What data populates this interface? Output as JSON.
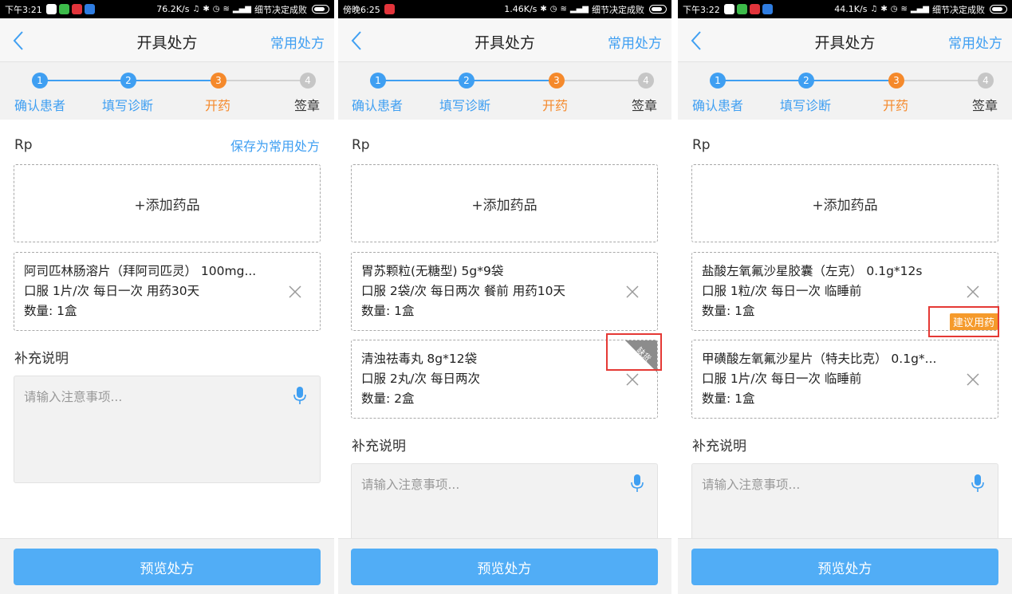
{
  "colors": {
    "accent": "#3f9ff2",
    "active_step": "#f5892b",
    "done_step": "#3f9ff2",
    "pending_step": "#c6c6c6",
    "button": "#51adf6",
    "alert": "#e53935",
    "suggest": "#f59a2b"
  },
  "screens": [
    {
      "status": {
        "time": "下午3:21",
        "speed": "76.2K/s",
        "carrier": "细节决定成败"
      },
      "nav": {
        "title": "开具处方",
        "action": "常用处方"
      },
      "steps": [
        {
          "num": "1",
          "label": "确认患者"
        },
        {
          "num": "2",
          "label": "填写诊断"
        },
        {
          "num": "3",
          "label": "开药"
        },
        {
          "num": "4",
          "label": "签章"
        }
      ],
      "rp": "Rp",
      "save_link": "保存为常用处方",
      "add_drug": "+添加药品",
      "drugs": [
        {
          "name": "阿司匹林肠溶片（拜阿司匹灵） 100mg...",
          "usage": "口服 1片/次 每日一次  用药30天",
          "qty": "数量: 1盒"
        }
      ],
      "note_label": "补充说明",
      "note_placeholder": "请输入注意事项...",
      "preview_button": "预览处方"
    },
    {
      "status": {
        "time": "傍晚6:25",
        "speed": "1.46K/s",
        "carrier": "细节决定成败"
      },
      "nav": {
        "title": "开具处方",
        "action": "常用处方"
      },
      "steps": [
        {
          "num": "1",
          "label": "确认患者"
        },
        {
          "num": "2",
          "label": "填写诊断"
        },
        {
          "num": "3",
          "label": "开药"
        },
        {
          "num": "4",
          "label": "签章"
        }
      ],
      "rp": "Rp",
      "add_drug": "+添加药品",
      "drugs": [
        {
          "name": "胃苏颗粒(无糖型) 5g*9袋",
          "usage": "口服 2袋/次 每日两次 餐前  用药10天",
          "qty": "数量: 1盒"
        },
        {
          "name": "清浊祛毒丸 8g*12袋",
          "usage": "口服 2丸/次 每日两次",
          "qty": "数量: 2盒",
          "badge": "缺货"
        }
      ],
      "note_label": "补充说明",
      "note_placeholder": "请输入注意事项...",
      "preview_button": "预览处方"
    },
    {
      "status": {
        "time": "下午3:22",
        "speed": "44.1K/s",
        "carrier": "细节决定成败"
      },
      "nav": {
        "title": "开具处方",
        "action": "常用处方"
      },
      "steps": [
        {
          "num": "1",
          "label": "确认患者"
        },
        {
          "num": "2",
          "label": "填写诊断"
        },
        {
          "num": "3",
          "label": "开药"
        },
        {
          "num": "4",
          "label": "签章"
        }
      ],
      "rp": "Rp",
      "add_drug": "+添加药品",
      "drugs": [
        {
          "name": "盐酸左氧氟沙星胶囊（左克） 0.1g*12s",
          "usage": "口服 1粒/次 每日一次 临睡前",
          "qty": "数量: 1盒",
          "badge": "建议用药"
        },
        {
          "name": "甲磺酸左氧氟沙星片（特夫比克） 0.1g*...",
          "usage": "口服 1片/次 每日一次 临睡前",
          "qty": "数量: 1盒"
        }
      ],
      "note_label": "补充说明",
      "note_placeholder": "请输入注意事项...",
      "preview_button": "预览处方"
    }
  ]
}
